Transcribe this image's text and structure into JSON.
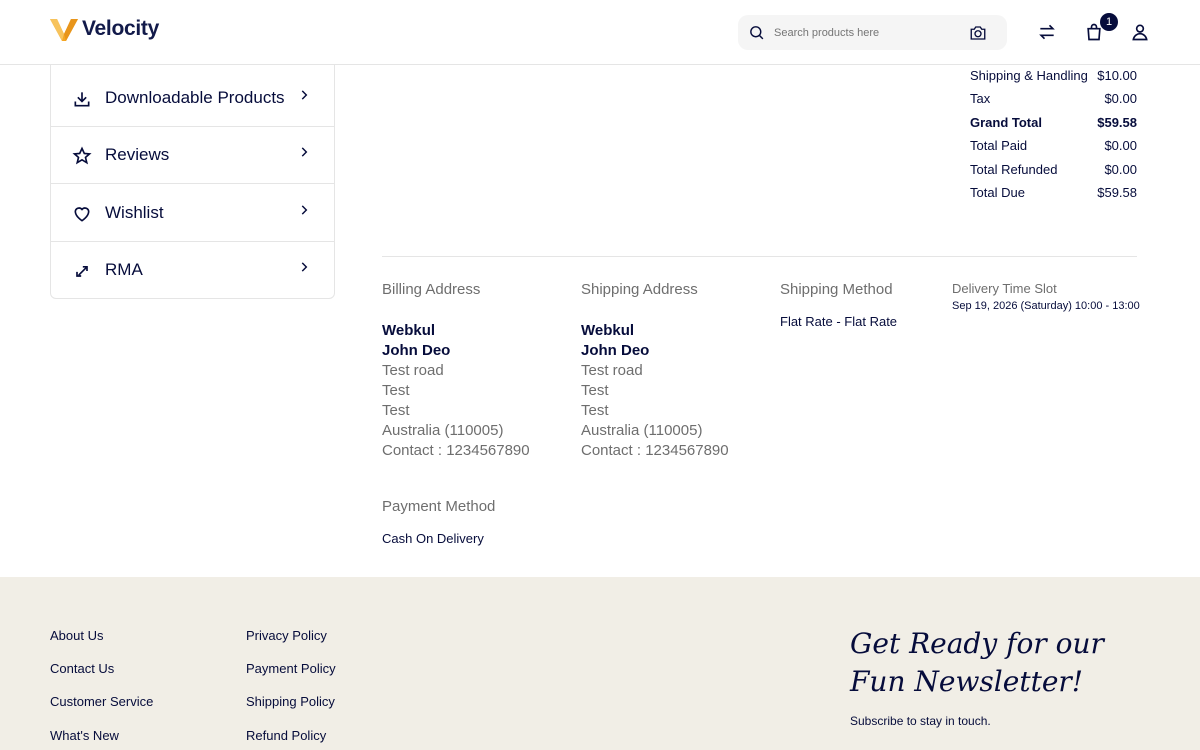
{
  "header": {
    "logo_text": "Velocity",
    "search_placeholder": "Search products here",
    "cart_count": "1"
  },
  "sidebar": {
    "items": [
      {
        "label": "Downloadable Products",
        "icon": "download-icon"
      },
      {
        "label": "Reviews",
        "icon": "star-icon"
      },
      {
        "label": "Wishlist",
        "icon": "heart-icon"
      },
      {
        "label": "RMA",
        "icon": "exchange-icon"
      }
    ]
  },
  "totals": [
    {
      "label": "Shipping & Handling",
      "value": "$10.00",
      "bold": false
    },
    {
      "label": "Tax",
      "value": "$0.00",
      "bold": false
    },
    {
      "label": "Grand Total",
      "value": "$59.58",
      "bold": true
    },
    {
      "label": "Total Paid",
      "value": "$0.00",
      "bold": false
    },
    {
      "label": "Total Refunded",
      "value": "$0.00",
      "bold": false
    },
    {
      "label": "Total Due",
      "value": "$59.58",
      "bold": false
    }
  ],
  "billing": {
    "heading": "Billing Address",
    "company": "Webkul",
    "name": "John Deo",
    "lines": [
      "Test road",
      "Test",
      "Test",
      "Australia (110005)",
      "Contact : 1234567890"
    ]
  },
  "shipping": {
    "heading": "Shipping Address",
    "company": "Webkul",
    "name": "John Deo",
    "lines": [
      "Test road",
      "Test",
      "Test",
      "Australia (110005)",
      "Contact : 1234567890"
    ]
  },
  "shipping_method": {
    "heading": "Shipping Method",
    "value": "Flat Rate - Flat Rate"
  },
  "delivery": {
    "heading": "Delivery Time Slot",
    "value": "Sep 19, 2026 (Saturday) 10:00 - 13:00"
  },
  "payment": {
    "heading": "Payment Method",
    "value": "Cash On Delivery"
  },
  "footer": {
    "col1": [
      "About Us",
      "Contact Us",
      "Customer Service",
      "What's New"
    ],
    "col2": [
      "Privacy Policy",
      "Payment Policy",
      "Shipping Policy",
      "Refund Policy"
    ],
    "newsletter_line1": "Get Ready for our",
    "newsletter_line2": "Fun Newsletter!",
    "newsletter_sub": "Subscribe to stay in touch."
  },
  "colors": {
    "brand_navy": "#060c3b",
    "footer_bg": "#f1eee6",
    "logo_orange": "#f5a623"
  }
}
